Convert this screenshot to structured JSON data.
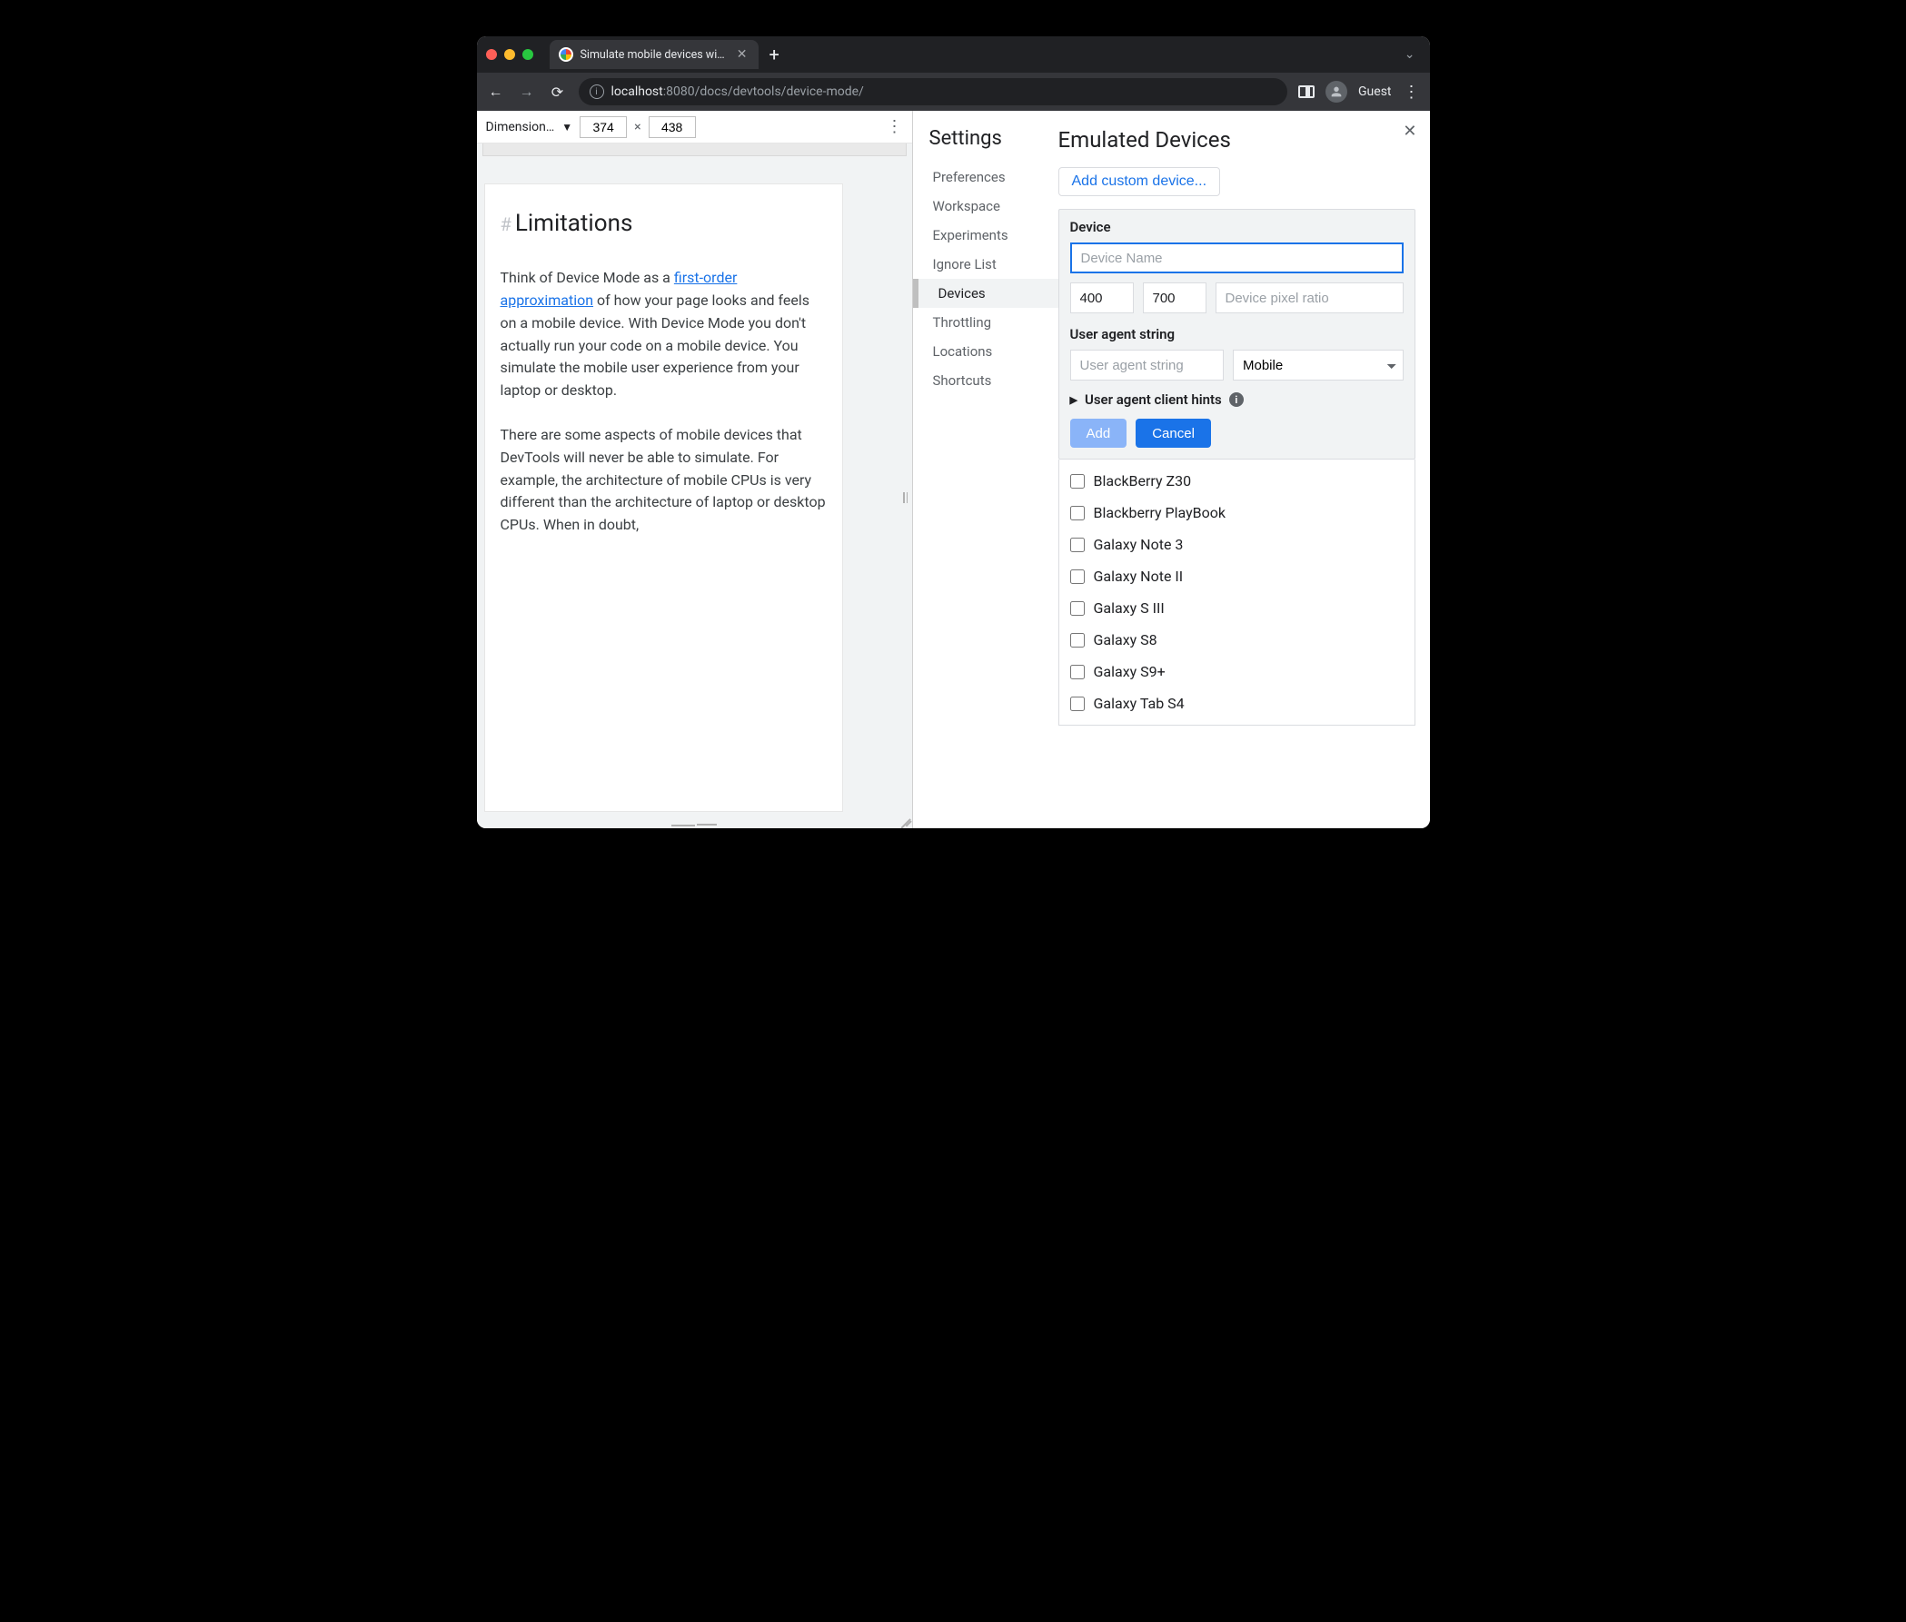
{
  "tab": {
    "title": "Simulate mobile devices with D"
  },
  "url": {
    "host": "localhost",
    "port": ":8080",
    "path": "/docs/devtools/device-mode/"
  },
  "guest_label": "Guest",
  "device_toolbar": {
    "label": "Dimension…",
    "width": "374",
    "height": "438"
  },
  "page": {
    "heading": "Limitations",
    "link_text": "first-order approximation",
    "p1a": "Think of Device Mode as a ",
    "p1b": " of how your page looks and feels on a mobile device. With Device Mode you don't actually run your code on a mobile device. You simulate the mobile user experience from your laptop or desktop.",
    "p2": "There are some aspects of mobile devices that DevTools will never be able to simulate. For example, the architecture of mobile CPUs is very different than the architecture of laptop or desktop CPUs. When in doubt,"
  },
  "settings": {
    "title": "Settings",
    "nav": [
      "Preferences",
      "Workspace",
      "Experiments",
      "Ignore List",
      "Devices",
      "Throttling",
      "Locations",
      "Shortcuts"
    ],
    "selected": "Devices"
  },
  "emulated": {
    "title": "Emulated Devices",
    "add_custom": "Add custom device...",
    "device_label": "Device",
    "name_placeholder": "Device Name",
    "width": "400",
    "height": "700",
    "dpr_placeholder": "Device pixel ratio",
    "ua_label": "User agent string",
    "ua_placeholder": "User agent string",
    "ua_type": "Mobile",
    "hints_label": "User agent client hints",
    "add_btn": "Add",
    "cancel_btn": "Cancel",
    "devices": [
      "BlackBerry Z30",
      "Blackberry PlayBook",
      "Galaxy Note 3",
      "Galaxy Note II",
      "Galaxy S III",
      "Galaxy S8",
      "Galaxy S9+",
      "Galaxy Tab S4"
    ]
  }
}
